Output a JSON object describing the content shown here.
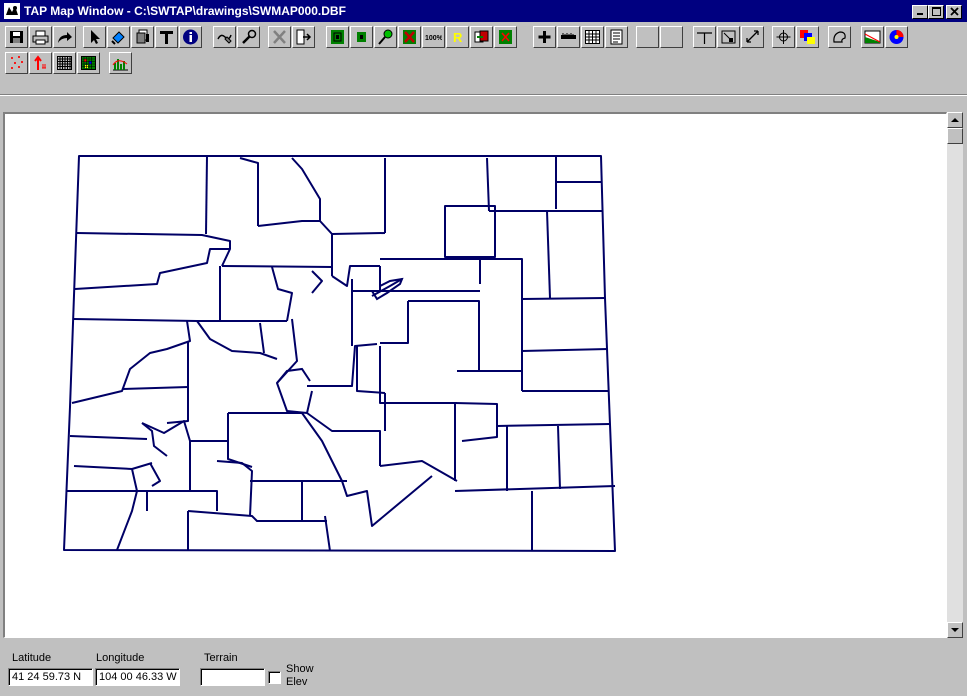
{
  "window": {
    "title": "TAP Map Window - C:\\SWTAP\\drawings\\SWMAP000.DBF",
    "minimize_label": "_",
    "maximize_label": "□",
    "close_label": "×"
  },
  "toolbar_row1": [
    {
      "name": "save-icon",
      "tip": "Save"
    },
    {
      "name": "print-icon",
      "tip": "Print"
    },
    {
      "name": "redo-icon",
      "tip": "Redo"
    },
    {
      "name": "pointer-icon",
      "tip": "Select"
    },
    {
      "name": "fill-icon",
      "tip": "Fill"
    },
    {
      "name": "layers-icon",
      "tip": "Layers"
    },
    {
      "name": "text-icon",
      "tip": "Text"
    },
    {
      "name": "info-icon",
      "tip": "Info"
    },
    {
      "name": "draw-icon",
      "tip": "Draw"
    },
    {
      "name": "tools-icon",
      "tip": "Tools"
    },
    {
      "name": "delete-icon",
      "tip": "Delete"
    },
    {
      "name": "exit-icon",
      "tip": "Exit"
    },
    {
      "name": "zoom-in-icon",
      "tip": "Zoom in"
    },
    {
      "name": "zoom-out-icon",
      "tip": "Zoom out"
    },
    {
      "name": "zoom-point-icon",
      "tip": "Zoom point"
    },
    {
      "name": "zoom-x-icon",
      "tip": "Zoom"
    },
    {
      "name": "zoom-100-icon",
      "tip": "100%"
    },
    {
      "name": "redraw-icon",
      "tip": "Redraw"
    },
    {
      "name": "zoom-previous-icon",
      "tip": "Previous"
    },
    {
      "name": "zoom-extent-icon",
      "tip": "Extent"
    },
    {
      "name": "crosshair-icon",
      "tip": "Crosshair"
    },
    {
      "name": "ruler-icon",
      "tip": "Ruler"
    },
    {
      "name": "grid-icon",
      "tip": "Grid"
    },
    {
      "name": "notes-icon",
      "tip": "Notes"
    },
    {
      "name": "blank-button-1",
      "tip": ""
    },
    {
      "name": "blank-button-2",
      "tip": ""
    },
    {
      "name": "profile-line-icon",
      "tip": "Profile"
    },
    {
      "name": "area-select-icon",
      "tip": "Area"
    },
    {
      "name": "resize-icon",
      "tip": "Resize"
    },
    {
      "name": "pan-icon",
      "tip": "Pan"
    },
    {
      "name": "color-layers-icon",
      "tip": "Colors"
    },
    {
      "name": "polygon-icon",
      "tip": "Polygon"
    },
    {
      "name": "terrain-profile-icon",
      "tip": "Terrain"
    },
    {
      "name": "coverage-icon",
      "tip": "Coverage"
    }
  ],
  "toolbar_row2": [
    {
      "name": "scatter-points-icon",
      "tip": "Points"
    },
    {
      "name": "antenna-icon",
      "tip": "Antenna"
    },
    {
      "name": "grid-mono-icon",
      "tip": "Grid"
    },
    {
      "name": "grid-color-icon",
      "tip": "Color grid"
    },
    {
      "name": "histogram-icon",
      "tip": "Histogram"
    }
  ],
  "status": {
    "latitude_label": "Latitude",
    "latitude_value": "41 24 59.73 N",
    "longitude_label": "Longitude",
    "longitude_value": "104 00 46.33 W",
    "terrain_label": "Terrain",
    "terrain_value": "",
    "show_elev_label_1": "Show",
    "show_elev_label_2": "Elev"
  },
  "colors": {
    "title_bar": "#000080",
    "county_lines": "#000066",
    "face": "#c0c0c0"
  },
  "map": {
    "subject": "Colorado county boundaries"
  }
}
